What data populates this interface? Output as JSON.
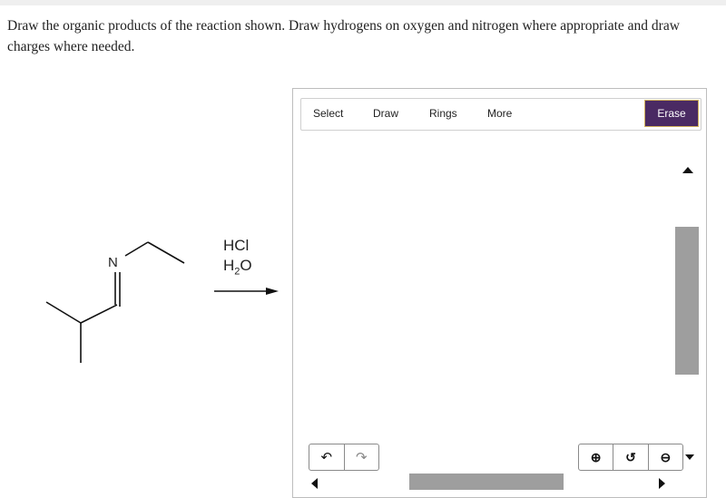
{
  "question": {
    "text": "Draw the organic products of the reaction shown. Draw hydrogens on oxygen and nitrogen where appropriate and draw charges where needed."
  },
  "scheme": {
    "atom_label": "N",
    "reagent1": "HCl",
    "reagent2_main": "H",
    "reagent2_sub": "2",
    "reagent2_end": "O"
  },
  "editor": {
    "toolbar": {
      "select": "Select",
      "draw": "Draw",
      "rings": "Rings",
      "more": "More",
      "erase": "Erase"
    },
    "icons": {
      "undo": "↶",
      "redo": "↷",
      "zoom_in": "⊕",
      "reset": "↺",
      "zoom_out": "⊖"
    },
    "colors": {
      "erase_bg": "#4a2a63",
      "erase_border": "#d0b15c",
      "scroll": "#9e9e9e"
    }
  }
}
